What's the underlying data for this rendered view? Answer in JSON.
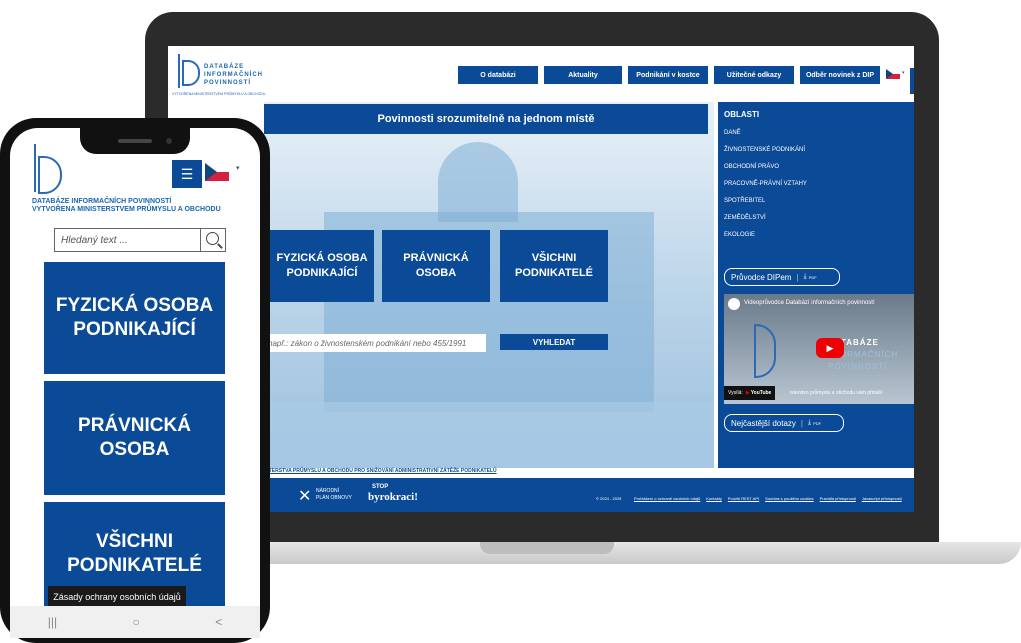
{
  "desktop": {
    "logo": {
      "line1": "DATABÁZE",
      "line2": "INFORMAČNÍCH",
      "line3": "POVINNOSTÍ",
      "subtitle": "VYTVOŘENA MINISTERSTVEM PRŮMYSLU A OBCHODU"
    },
    "nav": [
      "O databázi",
      "Aktuality",
      "Podnikání v kostce",
      "Užitečné odkazy",
      "Odběr novinek z DIP"
    ],
    "banner": "Povinnosti srozumitelně na jednom místě",
    "categories": [
      {
        "line1": "FYZICKÁ OSOBA",
        "line2": "PODNIKAJÍCÍ"
      },
      {
        "line1": "PRÁVNICKÁ",
        "line2": "OSOBA"
      },
      {
        "line1": "VŠICHNI",
        "line2": "PODNIKATELÉ"
      }
    ],
    "search_placeholder": "např.: zákon o živnostenském podnikání nebo 455/1991",
    "search_button": "VYHLEDAT",
    "areas_title": "OBLASTI",
    "areas": [
      "DANĚ",
      "ŽIVNOSTENSKÉ PODNIKÁNÍ",
      "OBCHODNÍ PRÁVO",
      "PRACOVNĚ-PRÁVNÍ VZTAHY",
      "SPOTŘEBITEL",
      "ZEMĚDĚLSTVÍ",
      "EKOLOGIE"
    ],
    "guide_button": "Průvodce DIPem",
    "pdf": "PDF",
    "video_title": "Videoprůvodce Databází informačních povinností",
    "video_logo": {
      "line1": "DATABÁZE",
      "line2": "INFORMAČNÍCH",
      "line3": "POVINNOSTÍ"
    },
    "video_watch": "Vysílá:",
    "video_youtube": "YouTube",
    "video_caption": "isterstvo průmyslu a obchodu vám přináší",
    "faq_button": "Nejčastější dotazy",
    "subline": "ISTERSTVA PRŮMYSLU A OBCHODU PRO SNIŽOVÁNÍ ADMINISTRATIVNÍ ZÁTĚŽE PODNIKATELŮ",
    "footer": {
      "npo_line1": "NÁRODNÍ",
      "npo_line2": "PLÁN OBNOVY",
      "stop_line1": "STOP",
      "stop_line2": "byrokraci!",
      "copyright": "© 2024 - 2025",
      "links": [
        "Prohlášení o ochraně osobních údajů",
        "Kontakty",
        "Použití REST API",
        "Souhlas s použitím cookies",
        "Pravidla přístupnosti",
        "Javascript přístupnosti"
      ]
    }
  },
  "mobile": {
    "logo_subtitle_1": "DATABÁZE INFORMAČNÍCH POVINNOSTÍ",
    "logo_subtitle_2": "VYTVOŘENA MINISTERSTVEM PRŮMYSLU A OBCHODU",
    "menu_icon": "☰",
    "search_placeholder": "Hledaný text ...",
    "categories": [
      {
        "line1": "FYZICKÁ OSOBA",
        "line2": "PODNIKAJÍCÍ"
      },
      {
        "line1": "PRÁVNICKÁ",
        "line2": "OSOBA"
      },
      {
        "line1": "VŠICHNI",
        "line2": "PODNIKATELÉ"
      }
    ],
    "cookie_text": "Zásady ochrany osobních údajů",
    "navbar": [
      "|||",
      "○",
      "<"
    ]
  },
  "colors": {
    "primary": "#0b4a97",
    "accent": "#2a6bb5"
  }
}
